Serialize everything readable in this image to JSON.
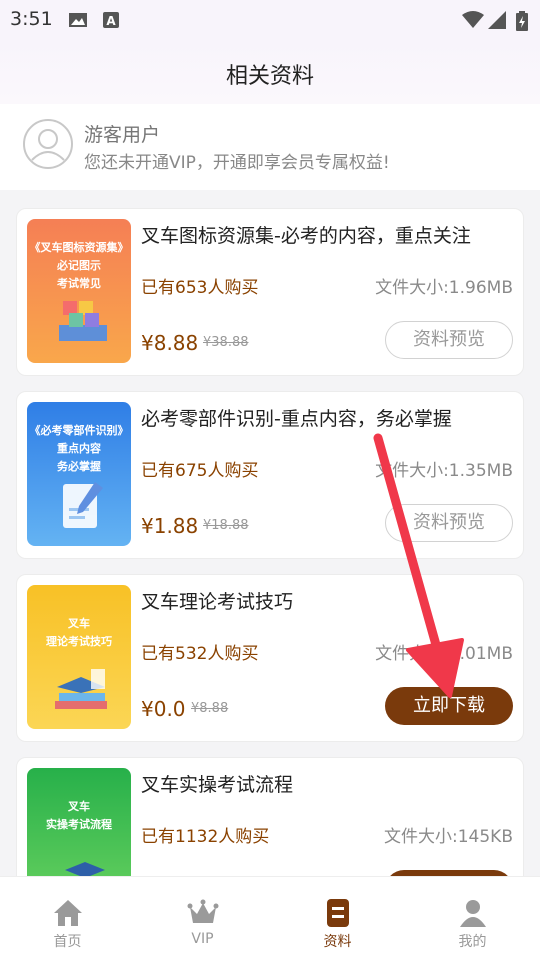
{
  "status_bar": {
    "time": "3:51"
  },
  "header": {
    "title": "相关资料"
  },
  "user": {
    "name": "游客用户",
    "subtitle": "您还未开通VIP，开通即享会员专属权益!"
  },
  "items": [
    {
      "title": "叉车图标资源集-必考的内容，重点关注",
      "cover_text": "《叉车图标资源集》\n必记图示\n考试常见",
      "buyers": "已有653人购买",
      "size": "文件大小:1.96MB",
      "price": "¥8.88",
      "original_price": "¥38.88",
      "button": "资料预览",
      "button_type": "preview"
    },
    {
      "title": "必考零部件识别-重点内容，务必掌握",
      "cover_text": "《必考零部件识别》\n重点内容\n务必掌握",
      "buyers": "已有675人购买",
      "size": "文件大小:1.35MB",
      "price": "¥1.88",
      "original_price": "¥18.88",
      "button": "资料预览",
      "button_type": "preview"
    },
    {
      "title": "叉车理论考试技巧",
      "cover_text": "叉车\n理论考试技巧",
      "buyers": "已有532人购买",
      "size": "文件大小:1.01MB",
      "price": "¥0.0",
      "original_price": "¥8.88",
      "button": "立即下载",
      "button_type": "download"
    },
    {
      "title": "叉车实操考试流程",
      "cover_text": "叉车\n实操考试流程",
      "buyers": "已有1132人购买",
      "size": "文件大小:145KB",
      "price": "",
      "original_price": "",
      "button": "",
      "button_type": "download"
    }
  ],
  "tabs": [
    {
      "label": "首页",
      "icon": "home-icon"
    },
    {
      "label": "VIP",
      "icon": "crown-icon"
    },
    {
      "label": "资料",
      "icon": "document-icon",
      "active": true
    },
    {
      "label": "我的",
      "icon": "person-icon"
    }
  ],
  "colors": {
    "accent": "#7a3a0c",
    "annotation_arrow": "#f0384a"
  }
}
